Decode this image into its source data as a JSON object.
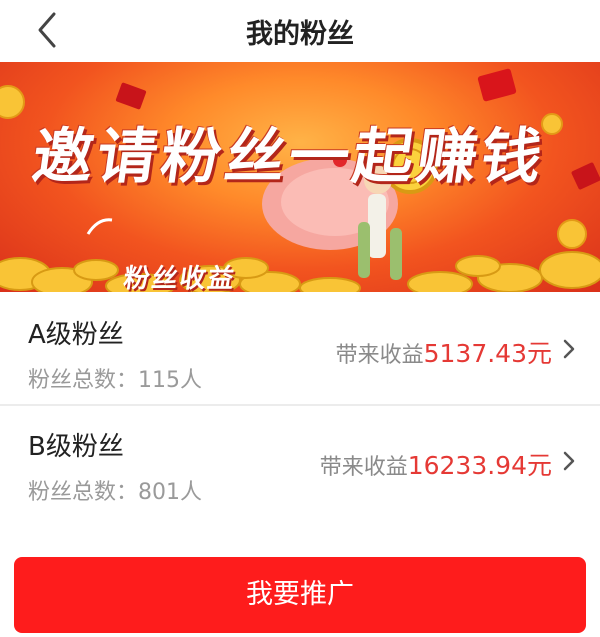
{
  "header": {
    "title": "我的粉丝",
    "back_icon": "chevron-left-icon"
  },
  "banner": {
    "title": "邀请粉丝一起赚钱",
    "subtitle": "粉丝收益"
  },
  "fan_levels": [
    {
      "name": "A级粉丝",
      "count_label": "粉丝总数：",
      "count_value": "115人",
      "income_label": "带来收益",
      "income_value": "5137.43元"
    },
    {
      "name": "B级粉丝",
      "count_label": "粉丝总数：",
      "count_value": "801人",
      "income_label": "带来收益",
      "income_value": "16233.94元"
    }
  ],
  "actions": {
    "promote_label": "我要推广"
  },
  "colors": {
    "accent": "#fe1c1c",
    "income": "#e53935",
    "muted": "#9a9a9a"
  }
}
